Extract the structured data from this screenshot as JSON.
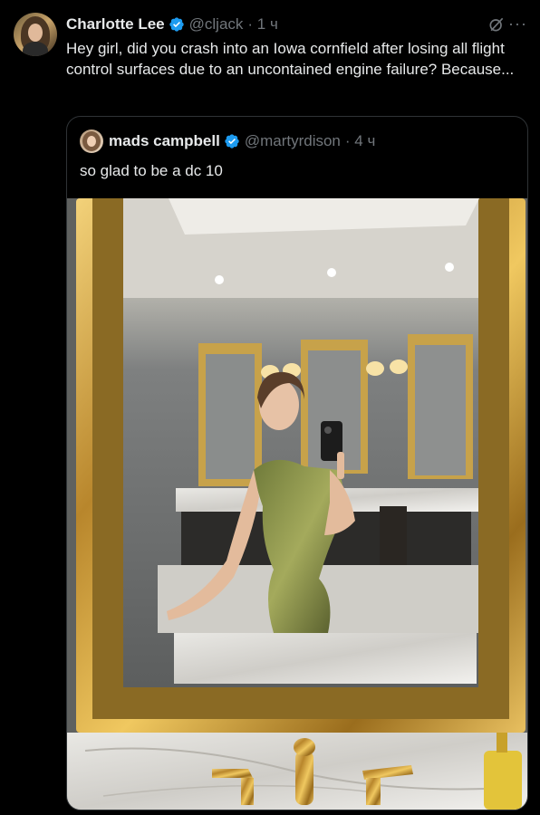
{
  "tweet": {
    "author_name": "Charlotte Lee",
    "author_handle": "@cljack",
    "time": "· 1 ч",
    "more": "···",
    "text": "Hey girl, did you crash into an Iowa cornfield after losing all flight control surfaces due to an uncontained engine failure? Because..."
  },
  "quote": {
    "author_name": "mads campbell",
    "author_handle": "@martyrdison",
    "time": "· 4 ч",
    "text": "so glad to be a dc 10"
  },
  "icons": {
    "verified": "verified-badge-icon",
    "grok": "grok-icon",
    "more": "more-options-icon"
  },
  "colors": {
    "background": "#000000",
    "text": "#e7e9ea",
    "secondary": "#71767b",
    "verified": "#1d9bf0",
    "border": "#2f3336"
  }
}
